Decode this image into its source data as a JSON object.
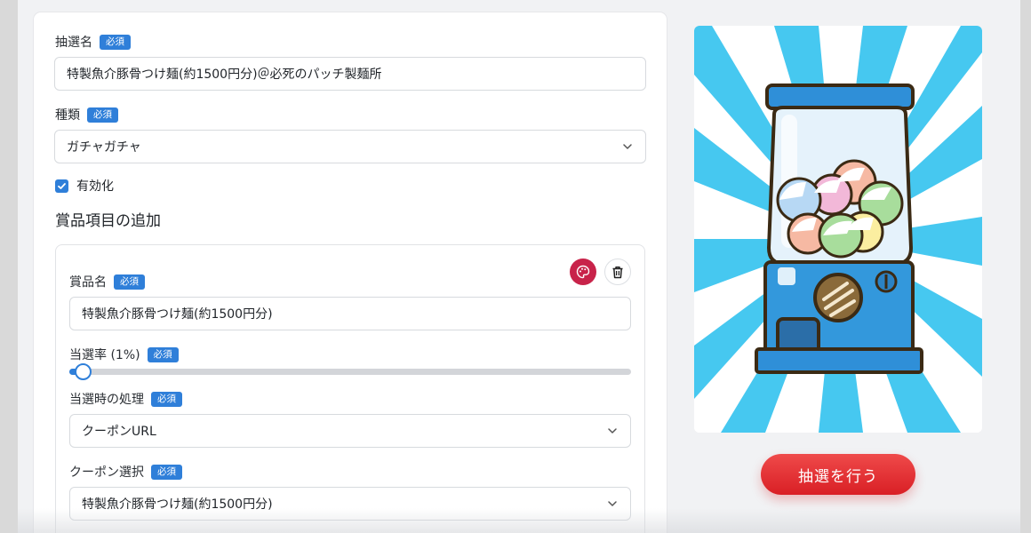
{
  "form": {
    "required_badge": "必須",
    "lottery_name": {
      "label": "抽選名",
      "value": "特製魚介豚骨つけ麺(約1500円分)＠必死のパッチ製麺所"
    },
    "type": {
      "label": "種類",
      "value": "ガチャガチャ"
    },
    "enabled": {
      "label": "有効化",
      "checked": true
    },
    "section_title": "賞品項目の追加",
    "prize": {
      "name_label": "賞品名",
      "name_value": "特製魚介豚骨つけ麺(約1500円分)",
      "rate_label": "当選率 (1%)",
      "rate_value_percent": 1,
      "action_label": "当選時の処理",
      "action_value": "クーポンURL",
      "coupon_label": "クーポン選択",
      "coupon_value": "特製魚介豚骨つけ麺(約1500円分)"
    }
  },
  "preview": {
    "image_icon": "gacha-machine-illustration",
    "draw_button_label": "抽選を行う"
  },
  "colors": {
    "accent": "#2f7fd9",
    "badge": "#2f7fd9",
    "palette_button": "#c8234a",
    "draw_button": "#e32a2f",
    "sunburst": "#46c8f0"
  }
}
